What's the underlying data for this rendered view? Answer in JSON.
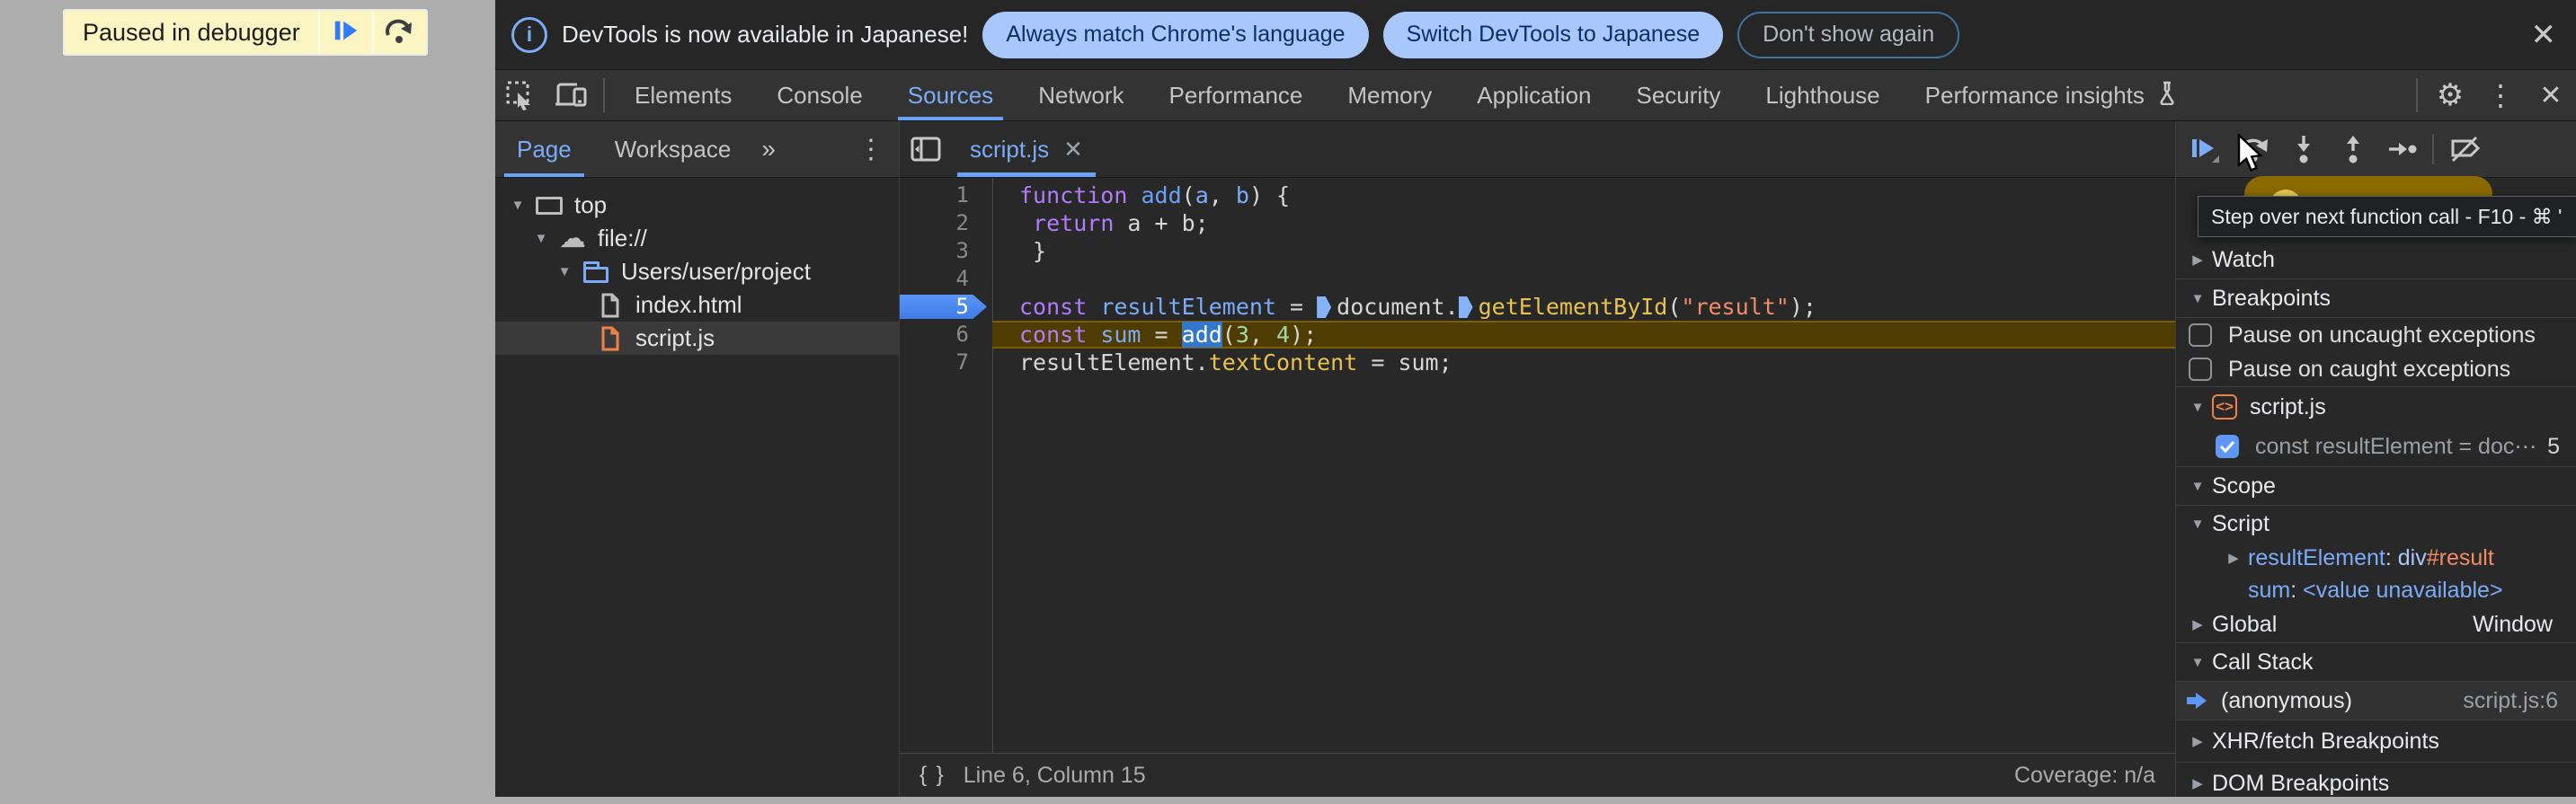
{
  "colors": {
    "accent_blue": "#7CACF8",
    "selection_blue": "#3377CC",
    "breakpoint_blue": "#4D8BF5",
    "paused_line_bg": "#4E3C00",
    "keyword_purple": "#B07CF7",
    "string_orange": "#F28B67",
    "method_yellow": "#E9C14E",
    "number_green": "#A3D9A5",
    "chip_bg": "#A8C7FA",
    "page_bg": "#ADADAD",
    "panel_bg": "#282828"
  },
  "paused_overlay": {
    "label": "Paused in debugger",
    "icons": [
      "resume-icon",
      "step-over-icon"
    ]
  },
  "infobar": {
    "icon": "info-icon",
    "message": "DevTools is now available in Japanese!",
    "buttons": {
      "match": "Always match Chrome's language",
      "switch_lang": "Switch DevTools to Japanese",
      "dismiss": "Don't show again"
    },
    "close": "✕"
  },
  "toolbar": {
    "icons": {
      "inspect": "inspect-icon",
      "device": "device-toolbar-icon",
      "flask": "flask-icon",
      "settings": "settings-gear-icon",
      "menu": "kebab-menu-icon",
      "close": "close-icon"
    },
    "tabs": [
      "Elements",
      "Console",
      "Sources",
      "Network",
      "Performance",
      "Memory",
      "Application",
      "Security",
      "Lighthouse",
      "Performance insights"
    ],
    "active_tab": "Sources",
    "settings_glyph": "⚙",
    "menu_glyph": "⋮",
    "close_glyph": "✕"
  },
  "files": {
    "tabs": {
      "page": "Page",
      "workspace": "Workspace",
      "more": "»",
      "menu": "⋮"
    },
    "active_tab": "Page",
    "tree": [
      {
        "label": "top",
        "icon": "frame-icon"
      },
      {
        "label": "file://",
        "icon": "cloud-icon"
      },
      {
        "label": "Users/user/project",
        "icon": "folder-icon"
      },
      {
        "label": "index.html",
        "icon": "file-icon"
      },
      {
        "label": "script.js",
        "icon": "file-icon-orange"
      }
    ]
  },
  "editor": {
    "tab": "script.js",
    "tab_close": "✕",
    "status": {
      "format_icon": "{ }",
      "position": "Line 6, Column 15",
      "coverage": "Coverage: n/a"
    },
    "lines": [
      {
        "n": "1",
        "tokens": [
          {
            "c": "kw",
            "t": "function"
          },
          {
            "c": "d",
            "t": " "
          },
          {
            "c": "fn",
            "t": "add"
          },
          {
            "c": "d",
            "t": "("
          },
          {
            "c": "var",
            "t": "a"
          },
          {
            "c": "d",
            "t": ", "
          },
          {
            "c": "var",
            "t": "b"
          },
          {
            "c": "d",
            "t": ") {"
          }
        ]
      },
      {
        "n": "2",
        "tokens": [
          {
            "c": "d",
            "t": " "
          },
          {
            "c": "kw",
            "t": "return"
          },
          {
            "c": "d",
            "t": " a + b;"
          }
        ]
      },
      {
        "n": "3",
        "tokens": [
          {
            "c": "d",
            "t": " }"
          }
        ]
      },
      {
        "n": "4",
        "tokens": []
      },
      {
        "n": "5",
        "tokens": [
          {
            "c": "kw",
            "t": "const"
          },
          {
            "c": "d",
            "t": " "
          },
          {
            "c": "var",
            "t": "resultElement"
          },
          {
            "c": "d",
            "t": " = "
          },
          {
            "c": "marker"
          },
          {
            "c": "d",
            "t": "document."
          },
          {
            "c": "marker"
          },
          {
            "c": "meth",
            "t": "getElementById"
          },
          {
            "c": "d",
            "t": "("
          },
          {
            "c": "str",
            "t": "\"result\""
          },
          {
            "c": "d",
            "t": ");"
          }
        ]
      },
      {
        "n": "6",
        "tokens": [
          {
            "c": "kw",
            "t": "const"
          },
          {
            "c": "d",
            "t": " "
          },
          {
            "c": "var",
            "t": "sum"
          },
          {
            "c": "d",
            "t": " = "
          },
          {
            "c": "sel",
            "t": "add"
          },
          {
            "c": "d",
            "t": "("
          },
          {
            "c": "num",
            "t": "3"
          },
          {
            "c": "d",
            "t": ", "
          },
          {
            "c": "num",
            "t": "4"
          },
          {
            "c": "d",
            "t": ");"
          }
        ]
      },
      {
        "n": "7",
        "tokens": [
          {
            "c": "d",
            "t": "resultElement."
          },
          {
            "c": "meth",
            "t": "textContent"
          },
          {
            "c": "d",
            "t": " = sum;"
          }
        ]
      }
    ],
    "breakpoint_line": "5",
    "paused_line": "6"
  },
  "debugger": {
    "controls": [
      "resume-icon",
      "step-over-icon",
      "step-into-icon",
      "step-out-icon",
      "step-icon",
      "deactivate-breakpoints-icon"
    ],
    "tooltip": "Step over next function call - F10 - ⌘ '",
    "watch": {
      "label": "Watch"
    },
    "breakpoints": {
      "label": "Breakpoints",
      "pause_uncaught": "Pause on uncaught exceptions",
      "pause_caught": "Pause on caught exceptions",
      "group": "script.js",
      "group_icon_glyph": "<>",
      "entry": {
        "code": "const resultElement = doc⋯",
        "line": "5"
      }
    },
    "scope": {
      "label": "Scope",
      "script_label": "Script",
      "vars": [
        {
          "name": "resultElement",
          "colon": ": ",
          "tag": "div",
          "id": "#result"
        },
        {
          "name": "sum",
          "colon": ": ",
          "value": "<value unavailable>"
        }
      ],
      "global_label": "Global",
      "global_value": "Window"
    },
    "call_stack": {
      "label": "Call Stack",
      "frame_name": "(anonymous)",
      "frame_location": "script.js:6"
    },
    "xhr_label": "XHR/fetch Breakpoints",
    "dom_label": "DOM Breakpoints"
  }
}
